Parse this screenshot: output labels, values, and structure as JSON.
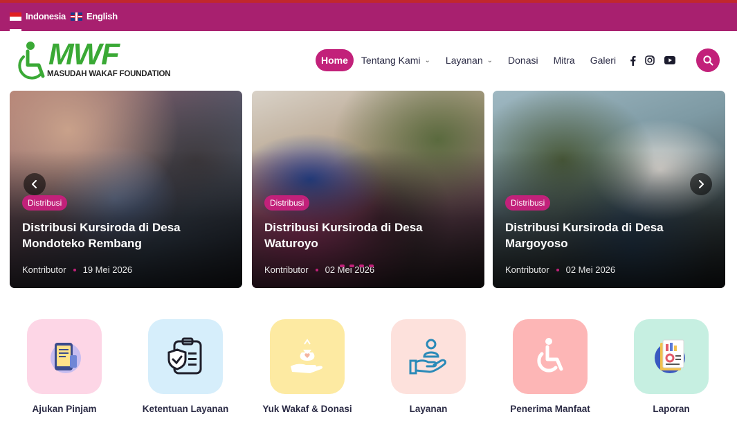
{
  "topbar": {
    "languages": [
      {
        "label": "Indonesia",
        "flag": "flag-indonesia-icon"
      },
      {
        "label": "English",
        "flag": "flag-uk-icon"
      }
    ],
    "colors": {
      "background": "#a8206f",
      "accent": "#c1272d"
    }
  },
  "logo": {
    "brand": "MWF",
    "tagline": "MASUDAH WAKAF FOUNDATION",
    "colors": {
      "brand": "#3aa935"
    }
  },
  "nav": {
    "items": [
      {
        "label": "Home",
        "active": true,
        "dropdown": false
      },
      {
        "label": "Tentang Kami",
        "active": false,
        "dropdown": true
      },
      {
        "label": "Layanan",
        "active": false,
        "dropdown": true
      },
      {
        "label": "Donasi",
        "active": false,
        "dropdown": false
      },
      {
        "label": "Mitra",
        "active": false,
        "dropdown": false
      },
      {
        "label": "Galeri",
        "active": false,
        "dropdown": false
      }
    ],
    "social": [
      "facebook-icon",
      "instagram-icon",
      "youtube-icon"
    ],
    "search_icon": "search-icon",
    "accent": "#c2217a"
  },
  "slider": {
    "cards": [
      {
        "category": "Distribusi",
        "title": "Distribusi Kursiroda di Desa Mondoteko Rembang",
        "author": "Kontributor",
        "date": "19 Mei 2026"
      },
      {
        "category": "Distribusi",
        "title": "Distribusi Kursiroda di Desa Waturoyo",
        "author": "Kontributor",
        "date": "02 Mei 2026"
      },
      {
        "category": "Distribusi",
        "title": "Distribusi Kursiroda di Desa Margoyoso",
        "author": "Kontributor",
        "date": "02 Mei 2026"
      }
    ],
    "prev_icon": "chevron-left-icon",
    "next_icon": "chevron-right-icon",
    "pager_count": 4
  },
  "services": [
    {
      "label": "Ajukan Pinjam",
      "icon": "phone-form-icon",
      "bg": "#fdd6e6"
    },
    {
      "label": "Ketentuan Layanan",
      "icon": "clipboard-shield-icon",
      "bg": "#d6eefb"
    },
    {
      "label": "Yuk Wakaf & Donasi",
      "icon": "hand-money-bag-icon",
      "bg": "#fdeaa2"
    },
    {
      "label": "Layanan",
      "icon": "hand-person-icon",
      "bg": "#fde1dc"
    },
    {
      "label": "Penerima Manfaat",
      "icon": "wheelchair-icon",
      "bg": "#fdb6b6"
    },
    {
      "label": "Laporan",
      "icon": "report-chart-icon",
      "bg": "#c6efe1"
    }
  ]
}
